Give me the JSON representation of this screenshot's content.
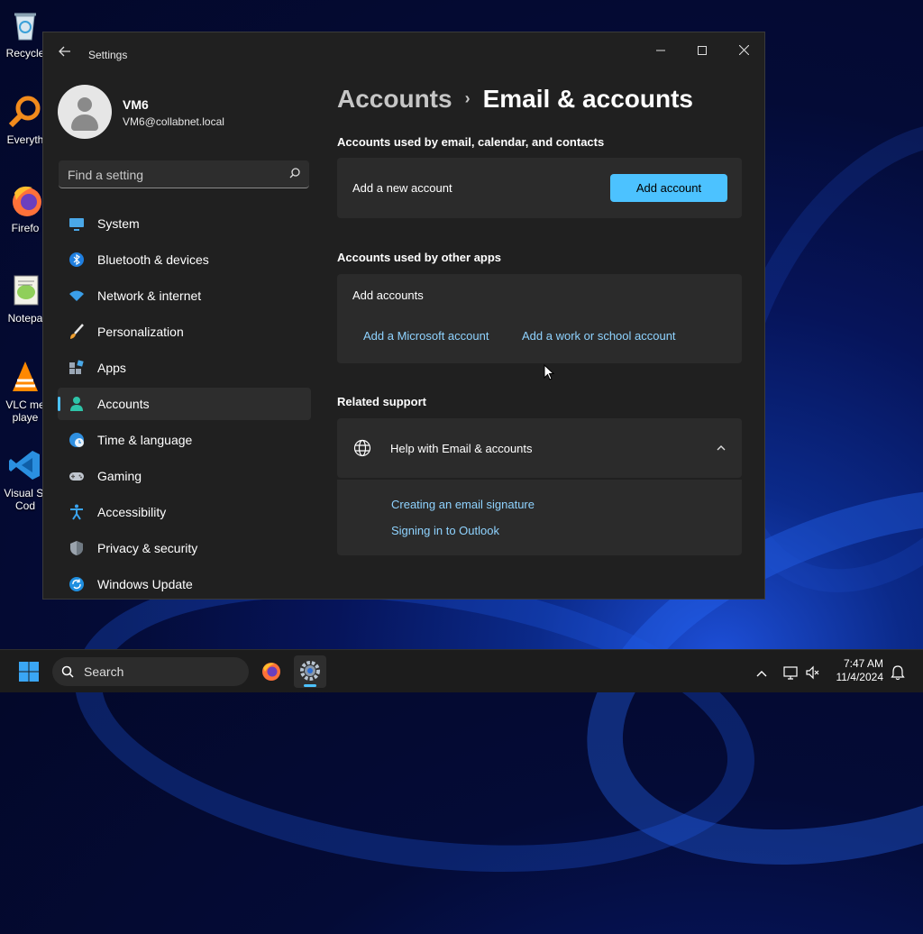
{
  "desktop": {
    "icons": [
      {
        "name": "recycle-bin",
        "label": "Recycle"
      },
      {
        "name": "everything",
        "label": "Everyth"
      },
      {
        "name": "firefox",
        "label": "Firefo"
      },
      {
        "name": "notepad-plus-plus",
        "label": "Notepa"
      },
      {
        "name": "vlc",
        "label": "VLC me\nplaye"
      },
      {
        "name": "vscode",
        "label": "Visual St\nCod"
      }
    ]
  },
  "window": {
    "title": "Settings",
    "controls": {
      "minimize": "—",
      "maximize": "☐",
      "close": "✕"
    }
  },
  "profile": {
    "name": "VM6",
    "email": "VM6@collabnet.local"
  },
  "search": {
    "placeholder": "Find a setting"
  },
  "nav": [
    {
      "label": "System",
      "icon": "monitor-icon",
      "active": false
    },
    {
      "label": "Bluetooth & devices",
      "icon": "bluetooth-icon",
      "active": false
    },
    {
      "label": "Network & internet",
      "icon": "wifi-icon",
      "active": false
    },
    {
      "label": "Personalization",
      "icon": "brush-icon",
      "active": false
    },
    {
      "label": "Apps",
      "icon": "apps-icon",
      "active": false
    },
    {
      "label": "Accounts",
      "icon": "person-icon",
      "active": true
    },
    {
      "label": "Time & language",
      "icon": "globe-clock-icon",
      "active": false
    },
    {
      "label": "Gaming",
      "icon": "gamepad-icon",
      "active": false
    },
    {
      "label": "Accessibility",
      "icon": "accessibility-icon",
      "active": false
    },
    {
      "label": "Privacy & security",
      "icon": "shield-icon",
      "active": false
    },
    {
      "label": "Windows Update",
      "icon": "update-icon",
      "active": false
    }
  ],
  "breadcrumb": {
    "parent": "Accounts",
    "separator": "›",
    "current": "Email & accounts"
  },
  "sections": {
    "email_accounts": {
      "title": "Accounts used by email, calendar, and contacts",
      "row_label": "Add a new account",
      "button": "Add account"
    },
    "other_apps": {
      "title": "Accounts used by other apps",
      "row_label": "Add accounts",
      "links": [
        "Add a Microsoft account",
        "Add a work or school account"
      ]
    },
    "related_support": {
      "title": "Related support",
      "help_title": "Help with Email & accounts",
      "links": [
        "Creating an email signature",
        "Signing in to Outlook"
      ]
    }
  },
  "taskbar": {
    "search_label": "Search",
    "time": "7:47 AM",
    "date": "11/4/2024"
  },
  "colors": {
    "accent": "#4cc2ff",
    "link": "#8fd3ff",
    "window_bg": "#202020",
    "card_bg": "#2b2b2b"
  }
}
